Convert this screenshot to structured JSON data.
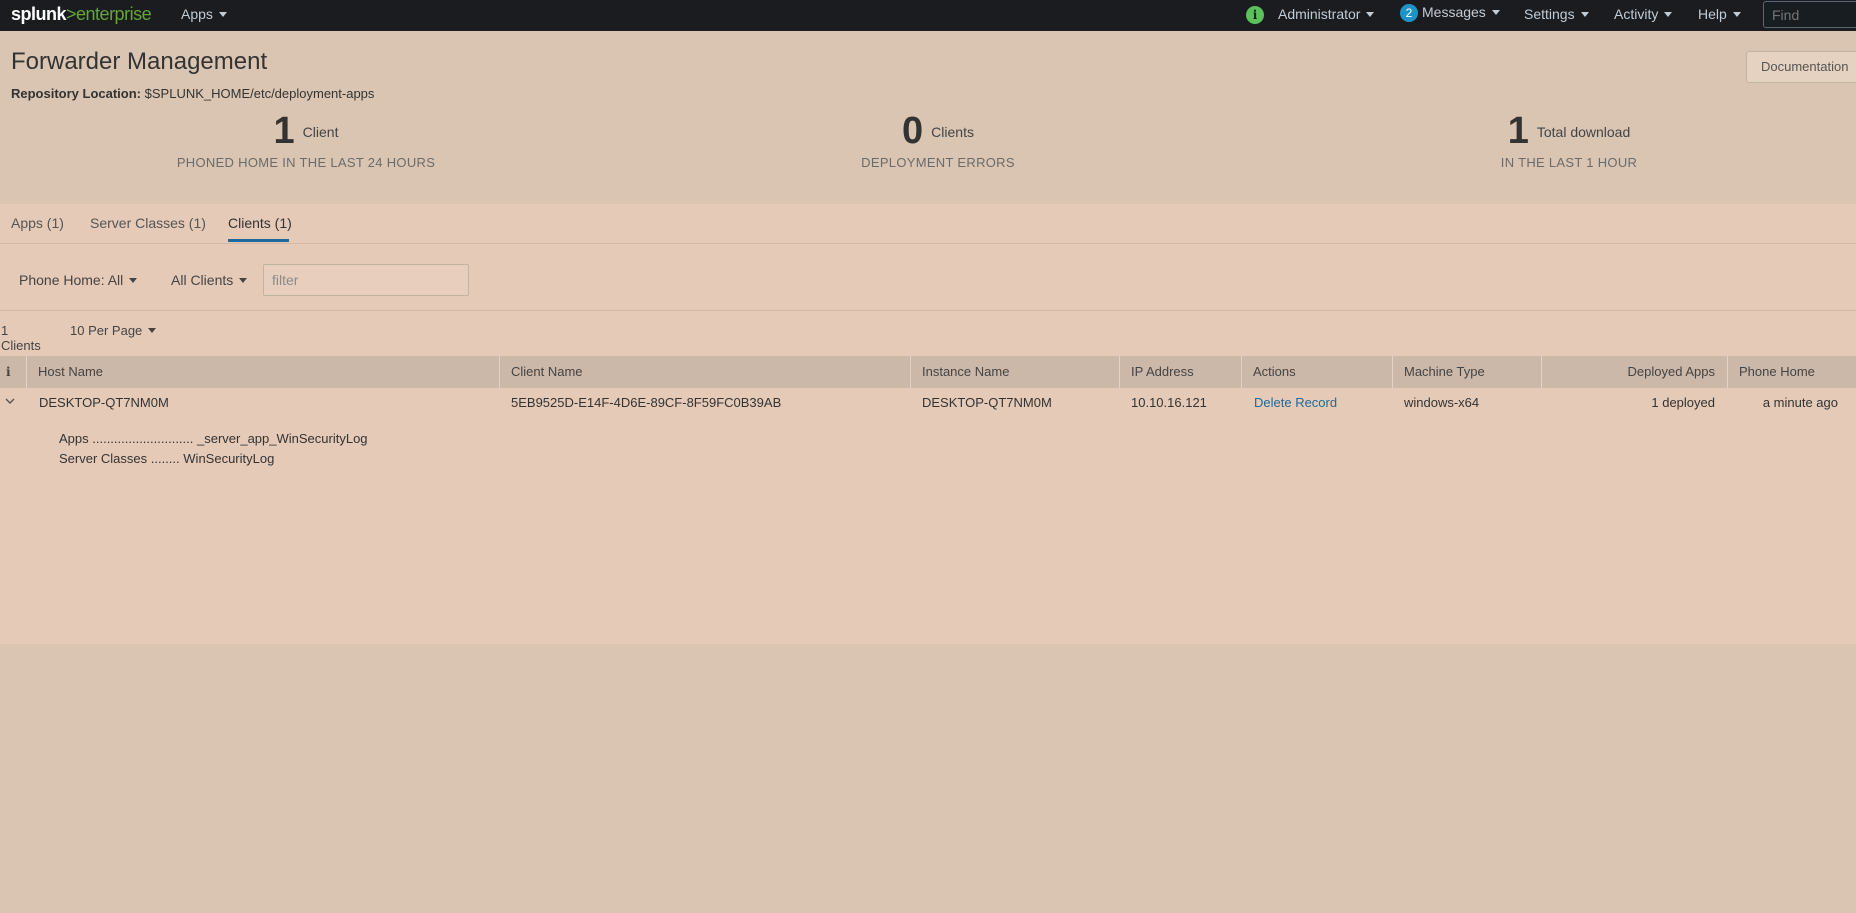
{
  "nav": {
    "logo_left": "splunk",
    "logo_gt": ">",
    "logo_right": "enterprise",
    "apps": "Apps",
    "info_icon": "i",
    "administrator": "Administrator",
    "messages_count": "2",
    "messages": "Messages",
    "settings": "Settings",
    "activity": "Activity",
    "help": "Help",
    "find_placeholder": "Find"
  },
  "header": {
    "title": "Forwarder Management",
    "repo_label": "Repository Location:",
    "repo_path": "$SPLUNK_HOME/etc/deployment-apps",
    "documentation": "Documentation"
  },
  "stats": [
    {
      "value": "1",
      "unit": "Client",
      "caption": "PHONED HOME IN THE LAST 24 HOURS"
    },
    {
      "value": "0",
      "unit": "Clients",
      "caption": "DEPLOYMENT ERRORS"
    },
    {
      "value": "1",
      "unit": "Total download",
      "caption": "IN THE LAST 1 HOUR"
    }
  ],
  "tabs": [
    {
      "label": "Apps (1)"
    },
    {
      "label": "Server Classes (1)"
    },
    {
      "label": "Clients (1)"
    }
  ],
  "filters": {
    "phone_home": "Phone Home: All",
    "clients": "All Clients",
    "filter_placeholder": "filter"
  },
  "list": {
    "count": "1 Clients",
    "per_page": "10 Per Page"
  },
  "table": {
    "info_header": "i",
    "headers": [
      "Host Name",
      "Client Name",
      "Instance Name",
      "IP Address",
      "Actions",
      "Machine Type",
      "Deployed Apps",
      "Phone Home"
    ],
    "rows": [
      {
        "host": "DESKTOP-QT7NM0M",
        "client": "5EB9525D-E14F-4D6E-89CF-8F59FC0B39AB",
        "instance": "DESKTOP-QT7NM0M",
        "ip": "10.10.16.121",
        "action": "Delete Record",
        "machine": "windows-x64",
        "deployed": "1 deployed",
        "phone_home": "a minute ago",
        "detail_apps_label": "Apps ............................",
        "detail_apps_value": "_server_app_WinSecurityLog",
        "detail_sc_label": "Server Classes ........",
        "detail_sc_value": "WinSecurityLog"
      }
    ]
  },
  "colors": {
    "accent": "#1e6a9a",
    "logo_green": "#65a637",
    "topbar": "#1a1c20"
  }
}
